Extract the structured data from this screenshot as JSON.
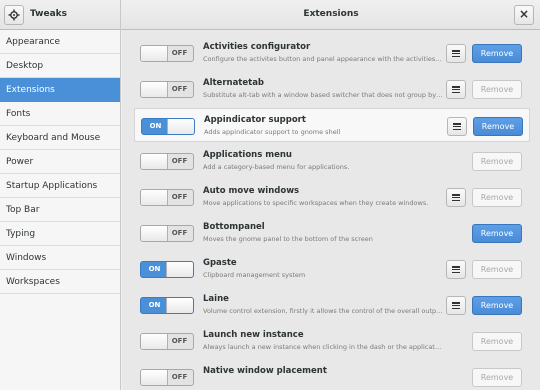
{
  "header": {
    "app_title": "Tweaks",
    "page_title": "Extensions",
    "close_glyph": "×"
  },
  "sidebar": {
    "selected": "Extensions",
    "items": [
      "Appearance",
      "Desktop",
      "Extensions",
      "Fonts",
      "Keyboard and Mouse",
      "Power",
      "Startup Applications",
      "Top Bar",
      "Typing",
      "Windows",
      "Workspaces"
    ]
  },
  "extensions": [
    {
      "name": "Activities configurator",
      "description": "Configure the activites button and panel appearance with the activities configu...",
      "enabled": false,
      "has_prefs": true,
      "remove_active": true
    },
    {
      "name": "Alternatetab",
      "description": "Substitute alt-tab with a window based switcher that does not group by applica...",
      "enabled": false,
      "has_prefs": true,
      "remove_active": false
    },
    {
      "name": "Appindicator support",
      "description": "Adds appindicator support to gnome shell",
      "enabled": true,
      "has_prefs": true,
      "remove_active": true
    },
    {
      "name": "Applications menu",
      "description": "Add a category-based menu for applications.",
      "enabled": false,
      "has_prefs": false,
      "remove_active": false
    },
    {
      "name": "Auto move windows",
      "description": "Move applications to specific workspaces when they create windows.",
      "enabled": false,
      "has_prefs": true,
      "remove_active": false
    },
    {
      "name": "Bottompanel",
      "description": "Moves the gnome panel to the bottom of the screen",
      "enabled": false,
      "has_prefs": false,
      "remove_active": true
    },
    {
      "name": "Gpaste",
      "description": "Clipboard management system",
      "enabled": true,
      "has_prefs": true,
      "remove_active": false
    },
    {
      "name": "Laine",
      "description": "Volume control extension, firstly it allows the control of the overall output volu...",
      "enabled": true,
      "has_prefs": true,
      "remove_active": true
    },
    {
      "name": "Launch new instance",
      "description": "Always launch a new instance when clicking in the dash or the application view.",
      "enabled": false,
      "has_prefs": false,
      "remove_active": false
    },
    {
      "name": "Native window placement",
      "description": "",
      "enabled": false,
      "has_prefs": false,
      "remove_active": false
    }
  ],
  "labels": {
    "on": "ON",
    "off": "OFF",
    "remove": "Remove"
  },
  "colors": {
    "accent": "#4a90d9",
    "headerbar": "#e8e8e8",
    "main_bg": "#e8e8e8",
    "sidebar_bg": "#f6f6f6"
  },
  "icons": {
    "app_menu": "tweaks-gear-icon",
    "close": "close-icon",
    "prefs": "hamburger-icon"
  }
}
